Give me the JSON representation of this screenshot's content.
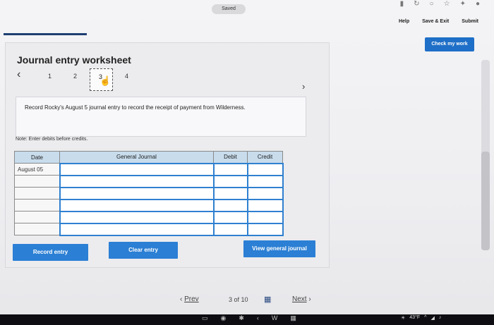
{
  "top": {
    "saved": "Saved",
    "help": "Help",
    "save_exit": "Save & Exit",
    "submit": "Submit",
    "check_work": "Check my work"
  },
  "panel": {
    "title": "Journal entry worksheet",
    "pages": [
      "1",
      "2",
      "3",
      "4"
    ],
    "instruction": "Record Rocky's August 5 journal entry to record the receipt of payment from Wilderness.",
    "note": "Note: Enter debits before credits."
  },
  "table": {
    "headers": [
      "Date",
      "General Journal",
      "Debit",
      "Credit"
    ],
    "date_value": "August 05"
  },
  "buttons": {
    "record": "Record entry",
    "clear": "Clear entry",
    "view": "View general journal"
  },
  "nav": {
    "prev": "Prev",
    "count": "3 of 10",
    "next": "Next"
  },
  "tray": {
    "temp": "43°F"
  }
}
